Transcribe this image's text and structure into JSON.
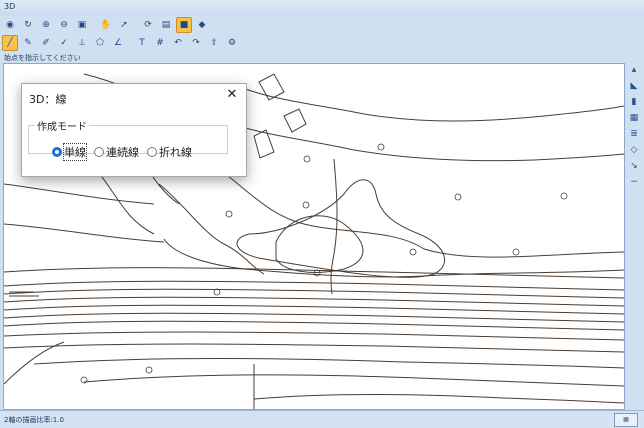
{
  "window": {
    "title": "3D"
  },
  "toolbar_row1": [
    "camera-icon",
    "rotate-icon",
    "zoom-in-icon",
    "zoom-out-icon",
    "fit-icon",
    "sep",
    "hand-icon",
    "select-icon",
    "sep",
    "refresh-icon",
    "print-icon",
    "color-icon",
    "layer-icon"
  ],
  "toolbar_row2": [
    "line-icon",
    "pen-icon",
    "edit-icon",
    "check-icon",
    "measure-icon",
    "polygon-icon",
    "angle-icon",
    "sep",
    "text-icon",
    "grid-icon",
    "undo-icon",
    "redo-icon",
    "export-icon",
    "settings-icon"
  ],
  "prompt_text": "始点を指示してください",
  "status_text": "2軸の描画比率:1.0",
  "dialog": {
    "title": "3D：線",
    "close": "✕",
    "group_label": "作成モード",
    "options": [
      {
        "label": "単線",
        "checked": true
      },
      {
        "label": "連続線",
        "checked": false
      },
      {
        "label": "折れ線",
        "checked": false
      }
    ]
  },
  "right_tools": [
    "up-icon",
    "shape-icon",
    "bar-icon",
    "tile-icon",
    "stack-icon",
    "diamond-icon",
    "arrow-icon",
    "minus-icon"
  ],
  "colors": {
    "accent": "#1f6fd0",
    "active_tool": "#f6c24a",
    "contour": "#4a3d33"
  }
}
